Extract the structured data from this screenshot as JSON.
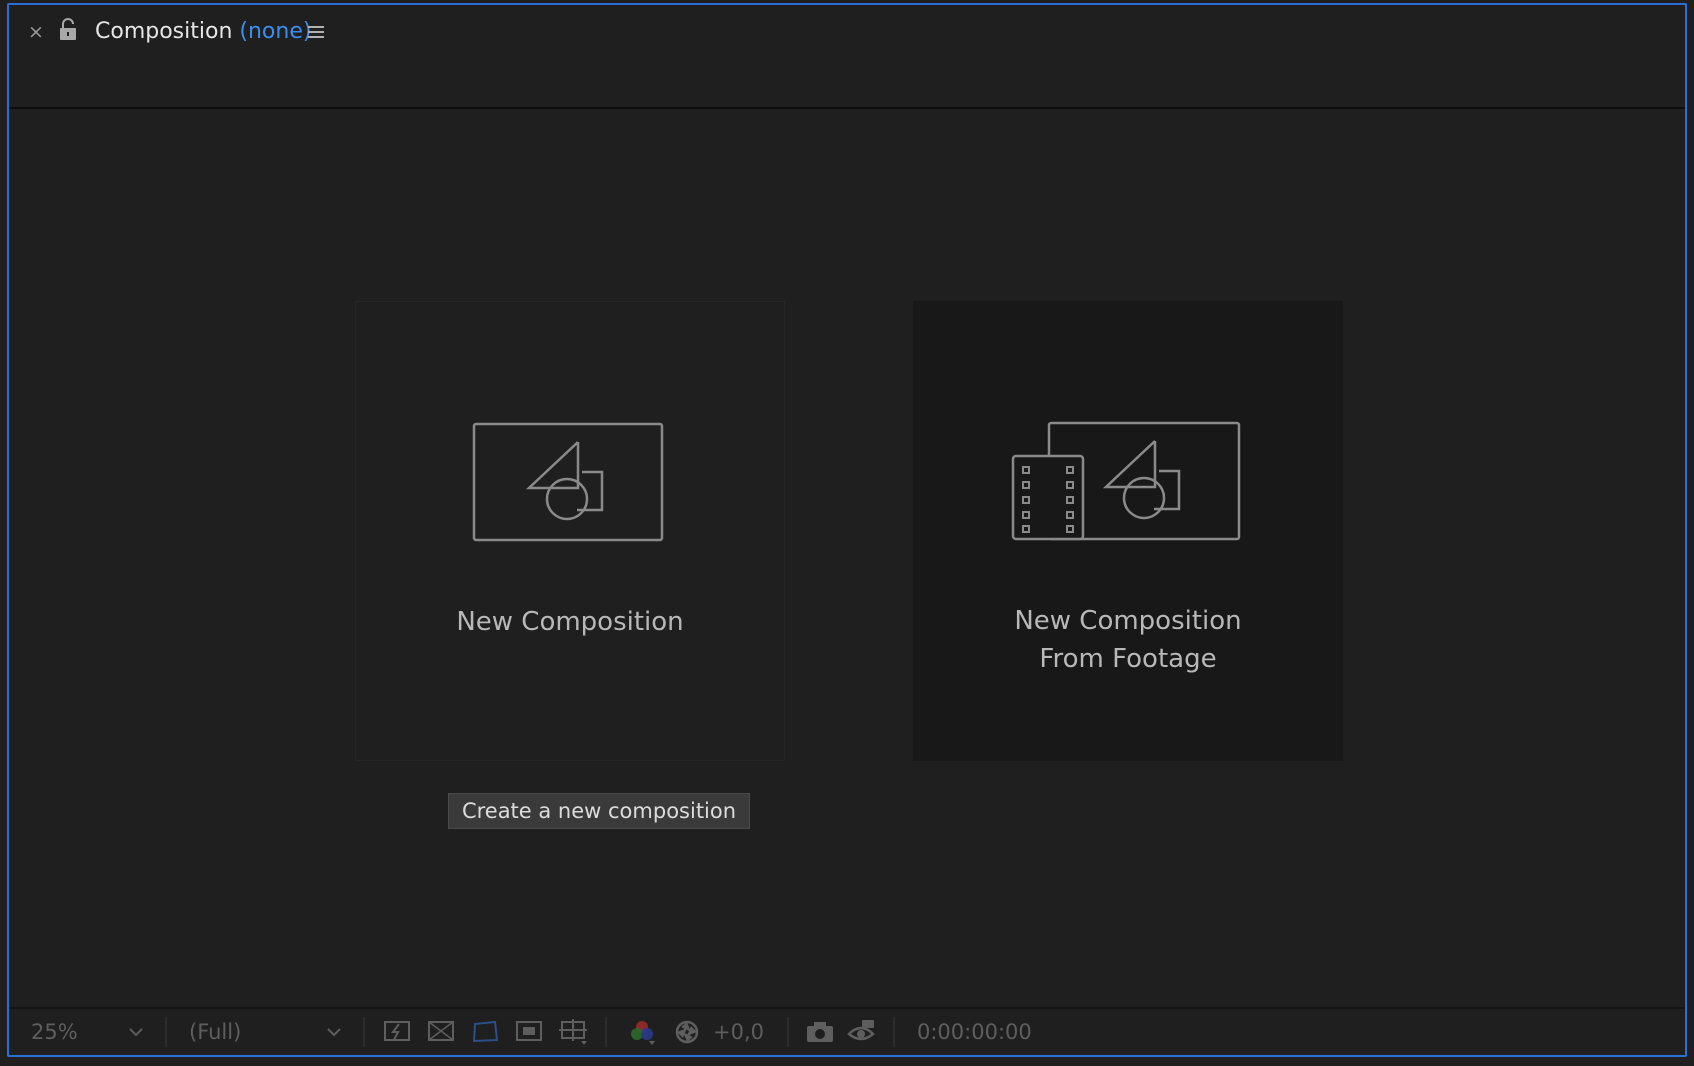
{
  "panel": {
    "title": "Composition",
    "title_suffix": "(none)",
    "accent": "#3b8ef0",
    "border_color": "#2b6fd6"
  },
  "icons": {
    "close": "close-icon",
    "lock": "lock-open-icon",
    "menu": "hamburger-menu-icon"
  },
  "cards": [
    {
      "label": "New Composition",
      "icon": "composition-icon"
    },
    {
      "label_line1": "New Composition",
      "label_line2": "From Footage",
      "icon": "composition-from-footage-icon"
    }
  ],
  "tooltip": {
    "text": "Create a new composition"
  },
  "bottombar": {
    "zoom": "25%",
    "resolution": "(Full)",
    "exposure": "+0,0",
    "timecode": "0:00:00:00"
  }
}
